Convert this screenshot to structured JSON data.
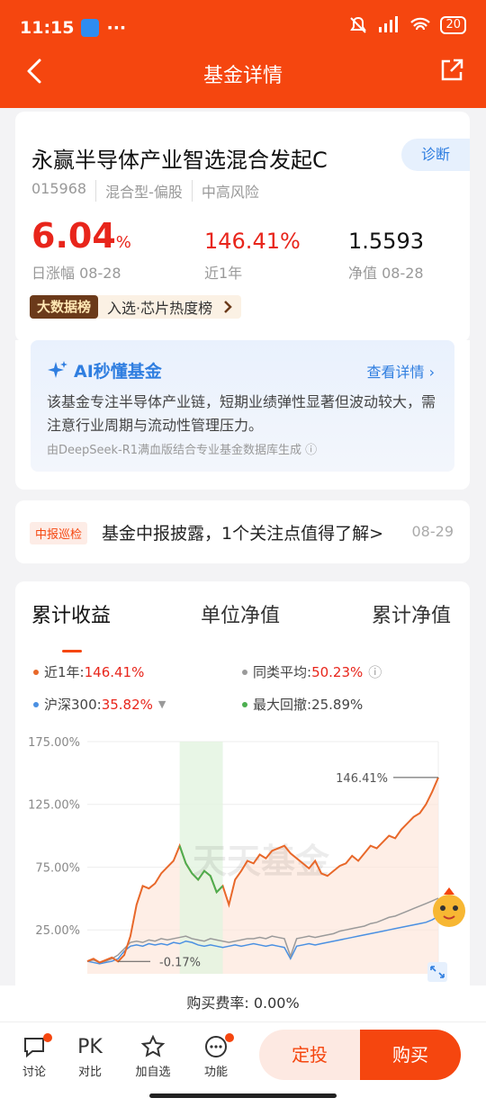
{
  "status": {
    "time": "11:15",
    "dots": "···",
    "battery": "20"
  },
  "nav": {
    "title": "基金详情"
  },
  "fund": {
    "name": "永赢半导体产业智选混合发起C",
    "diagnose": "诊断",
    "code": "015968",
    "type": "混合型-偏股",
    "risk": "中高风险",
    "day_change": "6.04",
    "day_change_unit": "%",
    "day_label": "日涨幅 08-28",
    "year_return": "146.41%",
    "year_label": "近1年",
    "nav_value": "1.5593",
    "nav_label": "净值 08-28",
    "bigdata_tag": "大数据榜",
    "bigdata_text": "入选·芯片热度榜"
  },
  "ai": {
    "title": "AI秒懂基金",
    "more": "查看详情",
    "body": "该基金专注半导体产业链，短期业绩弹性显著但波动较大，需注意行业周期与流动性管理压力。",
    "foot": "由DeepSeek-R1满血版结合专业基金数据库生成"
  },
  "report": {
    "tag": "中报巡检",
    "text": "基金中报披露，1个关注点值得了解>",
    "date": "08-29"
  },
  "chart_tabs": [
    "累计收益",
    "单位净值",
    "累计净值"
  ],
  "legend": {
    "l1_label": "近1年:",
    "l1_value": "146.41%",
    "l2_label": "同类平均:",
    "l2_value": "50.23%",
    "l3_label": "沪深300:",
    "l3_value": "35.82%",
    "l4_label": "最大回撤:",
    "l4_value": "25.89%"
  },
  "colors": {
    "accent": "#f5460f",
    "fund": "#e8682a",
    "peer": "#9a9a9a",
    "index": "#4a90e2",
    "drawdown": "#4caf50"
  },
  "chart_data": {
    "type": "line",
    "y_ticks": [
      "175.00%",
      "125.00%",
      "75.00%",
      "25.00%"
    ],
    "ylim": [
      -10,
      175
    ],
    "annotations": [
      "146.41%",
      "-0.17%"
    ],
    "watermark": "天天基金",
    "series": [
      {
        "name": "近1年",
        "values": [
          0,
          2,
          -1,
          1,
          3,
          -0.17,
          5,
          20,
          45,
          60,
          58,
          62,
          70,
          75,
          80,
          92,
          78,
          70,
          65,
          72,
          68,
          55,
          60,
          45,
          65,
          72,
          80,
          78,
          85,
          82,
          88,
          90,
          92,
          86,
          82,
          78,
          74,
          80,
          70,
          68,
          72,
          76,
          78,
          84,
          80,
          86,
          92,
          90,
          95,
          100,
          98,
          105,
          110,
          115,
          118,
          125,
          135,
          146.41
        ]
      },
      {
        "name": "同类平均",
        "values": [
          0,
          1,
          -1,
          0,
          2,
          5,
          10,
          15,
          16,
          15,
          17,
          16,
          18,
          17,
          18,
          19,
          20,
          18,
          17,
          16,
          18,
          17,
          16,
          15,
          16,
          17,
          18,
          18,
          19,
          18,
          20,
          19,
          18,
          4,
          18,
          19,
          20,
          19,
          20,
          21,
          22,
          24,
          25,
          26,
          27,
          28,
          30,
          31,
          33,
          35,
          36,
          38,
          40,
          42,
          44,
          46,
          48,
          50.23
        ]
      },
      {
        "name": "沪深300",
        "values": [
          0,
          -1,
          -2,
          -1,
          0,
          2,
          8,
          12,
          13,
          12,
          14,
          13,
          14,
          13,
          15,
          14,
          16,
          15,
          13,
          12,
          13,
          12,
          11,
          12,
          13,
          12,
          13,
          14,
          13,
          12,
          13,
          12,
          11,
          2,
          12,
          13,
          14,
          13,
          14,
          15,
          16,
          17,
          18,
          19,
          20,
          21,
          22,
          23,
          24,
          25,
          26,
          27,
          28,
          29,
          30,
          31,
          33,
          35.82
        ]
      }
    ]
  },
  "fee": "购买费率: 0.00%",
  "tabbar": {
    "discuss": "讨论",
    "pk_icon": "PK",
    "pk": "对比",
    "fav": "加自选",
    "func": "功能",
    "sip": "定投",
    "buy": "购买"
  }
}
